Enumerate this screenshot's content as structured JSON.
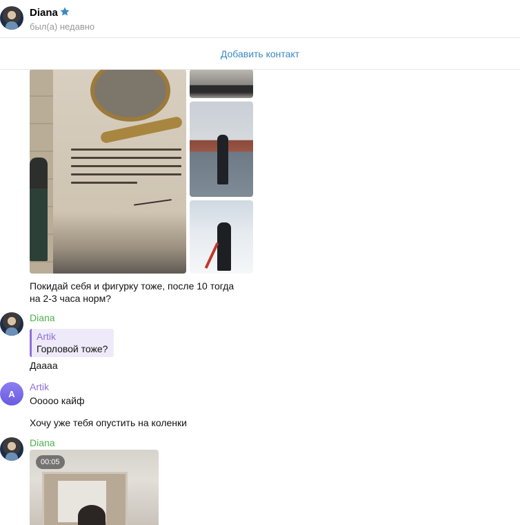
{
  "header": {
    "contact_name": "Diana",
    "status": "был(а) недавно",
    "verified_icon": "star-icon",
    "star_color": "#3a88c4"
  },
  "add_contact_label": "Добавить контакт",
  "messages": {
    "photo_caption_line1": "Покидай себя и фигурку тоже, после 10 тогда",
    "photo_caption_line2": "на 2-3 часа норм?",
    "diana_sender_1": "Diana",
    "reply_author": "Artik",
    "reply_quote": "Горловой тоже?",
    "diana_text_1": "Даааа",
    "artik_avatar_letter": "A",
    "artik_sender": "Artik",
    "artik_text_1": "Ооооо кайф",
    "artik_text_2": "Хочу уже тебя опустить на коленки",
    "diana_sender_2": "Diana",
    "video_duration": "00:05"
  },
  "colors": {
    "diana_name": "#4fae4e",
    "artik_name": "#8e6fd8",
    "link": "#3a88c4"
  }
}
